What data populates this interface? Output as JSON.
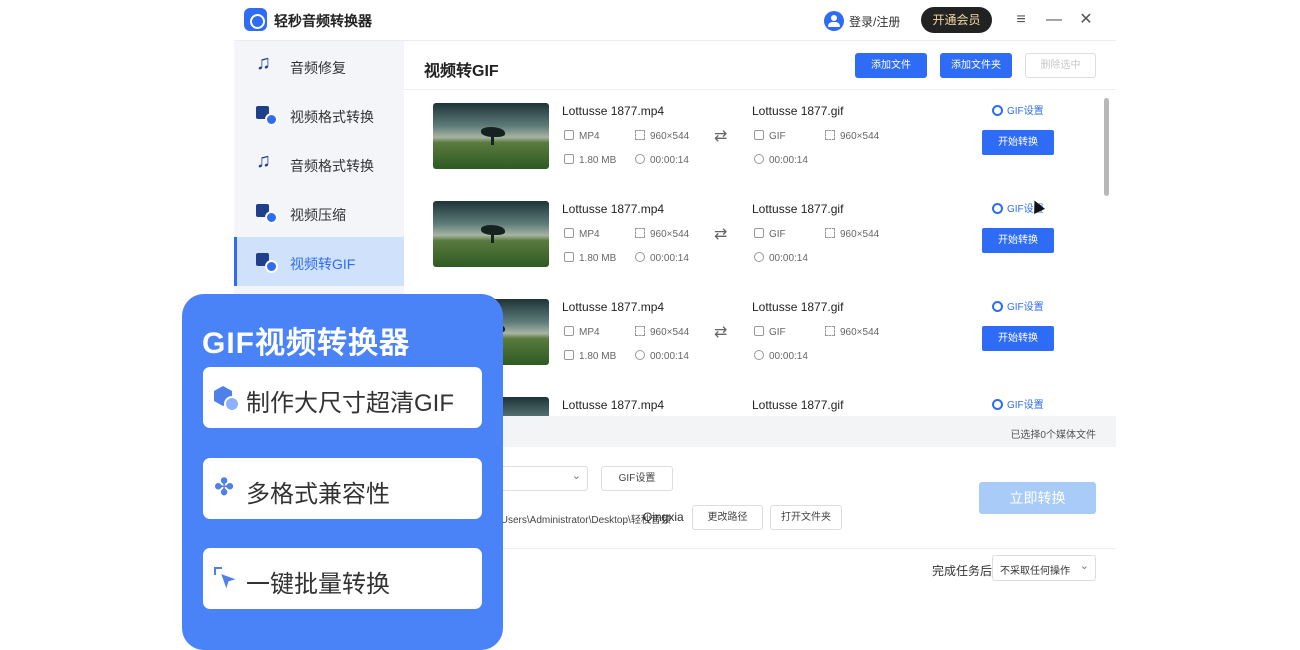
{
  "app": {
    "title": "轻秒音频转换器",
    "login_label": "登录/注册",
    "vip_label": "开通会员"
  },
  "sidebar": {
    "items": [
      {
        "label": "音频修复",
        "icon": "music-note-icon",
        "active": false
      },
      {
        "label": "视频格式转换",
        "icon": "video-convert-icon",
        "active": false
      },
      {
        "label": "音频格式转换",
        "icon": "music-note-icon",
        "active": false
      },
      {
        "label": "视频压缩",
        "icon": "video-compress-icon",
        "active": false
      },
      {
        "label": "视频转GIF",
        "icon": "video-gif-icon",
        "active": true
      }
    ]
  },
  "main": {
    "title": "视频转GIF",
    "add_file": "添加文件",
    "add_folder": "添加文件夹",
    "delete_selected": "删除选中"
  },
  "files": [
    {
      "src_name": "Lottusse 1877.mp4",
      "src_format": "MP4",
      "src_resolution": "960×544",
      "src_size": "1.80 MB",
      "src_duration": "00:00:14",
      "dst_name": "Lottusse 1877.gif",
      "dst_format": "GIF",
      "dst_resolution": "960×544",
      "dst_duration": "00:00:14",
      "gif_setting": "GIF设置",
      "start": "开始转换"
    },
    {
      "src_name": "Lottusse 1877.mp4",
      "src_format": "MP4",
      "src_resolution": "960×544",
      "src_size": "1.80 MB",
      "src_duration": "00:00:14",
      "dst_name": "Lottusse 1877.gif",
      "dst_format": "GIF",
      "dst_resolution": "960×544",
      "dst_duration": "00:00:14",
      "gif_setting": "GIF设置",
      "start": "开始转换"
    },
    {
      "src_name": "Lottusse 1877.mp4",
      "src_format": "MP4",
      "src_resolution": "960×544",
      "src_size": "1.80 MB",
      "src_duration": "00:00:14",
      "dst_name": "Lottusse 1877.gif",
      "dst_format": "GIF",
      "dst_resolution": "960×544",
      "dst_duration": "00:00:14",
      "gif_setting": "GIF设置",
      "start": "开始转换"
    },
    {
      "src_name": "Lottusse 1877.mp4",
      "dst_name": "Lottusse 1877.gif",
      "gif_setting": "GIF设置"
    }
  ],
  "status": {
    "selected_text": "已选择0个媒体文件"
  },
  "bottom": {
    "gif_setting": "GIF设置",
    "path": "\\Users\\Administrator\\Desktop\\轻秒音频",
    "path_overlay": "Qingxia",
    "change_path": "更改路径",
    "open_folder": "打开文件夹",
    "convert_now": "立即转换",
    "after_task_label": "完成任务后",
    "after_task_value": "不采取任何操作"
  },
  "promo": {
    "title": "GIF视频转换器",
    "features": [
      {
        "label": "制作大尺寸超清GIF",
        "icon": "cube-icon"
      },
      {
        "label": "多格式兼容性",
        "icon": "clover-icon"
      },
      {
        "label": "一键批量转换",
        "icon": "click-cursor-icon"
      }
    ]
  },
  "colors": {
    "accent": "#2f6cf6",
    "sidebar_bg": "#f3f5f9",
    "active_bg": "#cfe1fb",
    "promo_bg": "#4a82f7",
    "convert_disabled": "#a9cbf8"
  }
}
